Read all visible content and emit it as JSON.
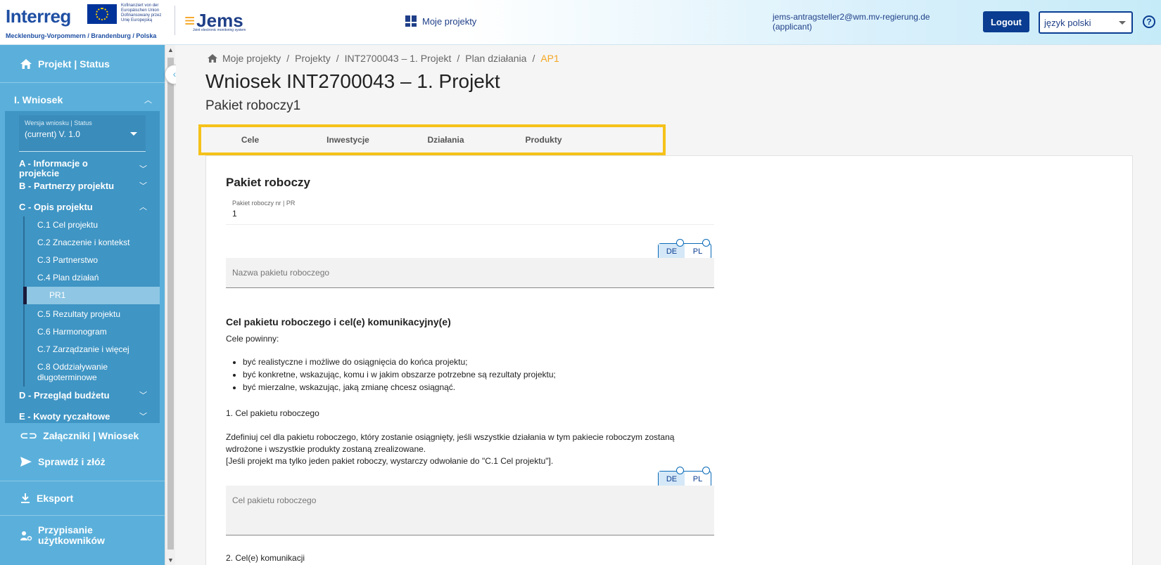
{
  "header": {
    "logo_main": "Interreg",
    "logo_region": "Mecklenburg-Vorpommern / Brandenburg / Polska",
    "eu_text_1": "Kofinanziert von der",
    "eu_text_2": "Europäischen Union",
    "eu_text_3": "Dofinansowany przez",
    "eu_text_4": "Unię Europejską",
    "jems_logo": "Jems",
    "jems_tagline": "Joint electronic monitoring system",
    "my_projects_label": "Moje projekty",
    "user_email": "jems-antragsteller2@wm.mv-regierung.de",
    "user_role": "(applicant)",
    "logout_label": "Logout",
    "language_value": "język polski",
    "help_label": "?"
  },
  "sidebar": {
    "project_status": "Projekt | Status",
    "section_i": "I. Wniosek",
    "version_label": "Wersja wniosku | Status",
    "version_value": "(current) V. 1.0",
    "group_a": "A - Informacje o projekcie",
    "group_b": "B - Partnerzy projektu",
    "group_c": "C - Opis projektu",
    "c_items": [
      "C.1 Cel projektu",
      "C.2 Znaczenie i kontekst",
      "C.3 Partnerstwo",
      "C.4 Plan działań"
    ],
    "pr1": "PR1",
    "c_items_2": [
      "C.5 Rezultaty projektu",
      "C.6 Harmonogram",
      "C.7 Zarządzanie i więcej",
      "C.8 Oddziaływanie długoterminowe"
    ],
    "group_d": "D - Przegląd budżetu",
    "group_e": "E - Kwoty ryczałtowe",
    "attachments": "Załączniki | Wniosek",
    "check_submit": "Sprawdź i złóż",
    "export": "Eksport",
    "assign_users": "Przypisanie użytkowników"
  },
  "breadcrumb": [
    "Moje projekty",
    "Projekty",
    "INT2700043 – 1. Projekt",
    "Plan działania",
    "AP1"
  ],
  "page": {
    "title": "Wniosek INT2700043 – 1. Projekt",
    "subtitle": "Pakiet roboczy1"
  },
  "tabs": [
    "Cele",
    "Inwestycje",
    "Działania",
    "Produkty"
  ],
  "card": {
    "title": "Pakiet roboczy",
    "wp_number_label": "Pakiet roboczy nr | PR",
    "wp_number_value": "1",
    "lang_de": "DE",
    "lang_pl": "PL",
    "wp_name_placeholder": "Nazwa pakietu roboczego",
    "objective_heading": "Cel pakietu roboczego i cel(e) komunikacyjny(e)",
    "objectives_intro": "Cele powinny:",
    "bullets": [
      "być realistyczne i możliwe do osiągnięcia do końca projektu;",
      "być konkretne, wskazując, komu i w jakim obszarze potrzebne są rezultaty projektu;",
      "być mierzalne, wskazując, jaką zmianę chcesz osiągnąć."
    ],
    "objective_1_heading": "1. Cel pakietu roboczego",
    "objective_1_text_1": "Zdefiniuj cel dla pakietu roboczego, który zostanie osiągnięty, jeśli wszystkie działania w tym pakiecie roboczym zostaną",
    "objective_1_text_2": "wdrożone i wszystkie produkty zostaną zrealizowane.",
    "objective_1_text_3": "[Jeśli projekt ma tylko jeden pakiet roboczy, wystarczy odwołanie do \"C.1 Cel projektu\"].",
    "objective_placeholder": "Cel pakietu roboczego",
    "communication_heading": "2. Cel(e) komunikacji"
  },
  "colors": {
    "sidebar_bg": "#5bb0db",
    "primary": "#0a3d91",
    "accent_highlight": "#f5c21a",
    "breadcrumb_current": "#f5a623"
  }
}
